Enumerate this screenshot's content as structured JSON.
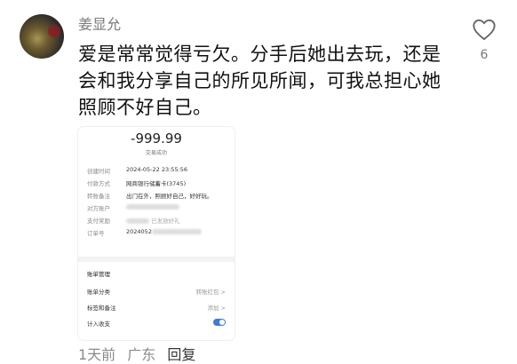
{
  "comment": {
    "username": "姜显允",
    "like_count": "6",
    "text": "爱是常常觉得亏欠。分手后她出去玩，还是会和我分享自己的所见所闻，可我总担心她照顾不好自己。",
    "footer": {
      "time": "1天前",
      "location": "广东",
      "reply": "回复"
    },
    "icons": {
      "avatar": "user-avatar",
      "like": "heart-icon"
    }
  },
  "receipt": {
    "amount": "-999.99",
    "status": "交易成功",
    "rows": [
      {
        "key": "创建时间",
        "value": "2024-05-22 23:55:56"
      },
      {
        "key": "付款方式",
        "value": "网商银行储蓄卡(3745)"
      },
      {
        "key": "转账备注",
        "value": "出门在外，照顾好自己，好好玩。"
      },
      {
        "key": "对方账户",
        "value": ""
      },
      {
        "key": "支付奖励",
        "value": "已发放好礼"
      },
      {
        "key": "订单号",
        "value": "2024052"
      }
    ],
    "section_title": "账单管理",
    "settings": [
      {
        "key": "账单分类",
        "value": "转账红包 >"
      },
      {
        "key": "标签和备注",
        "value": "添加 >"
      },
      {
        "key": "计入收支",
        "value": ""
      }
    ]
  },
  "colors": {
    "accent": "#3b7ddd",
    "meta_gray": "#7a7a7a"
  }
}
